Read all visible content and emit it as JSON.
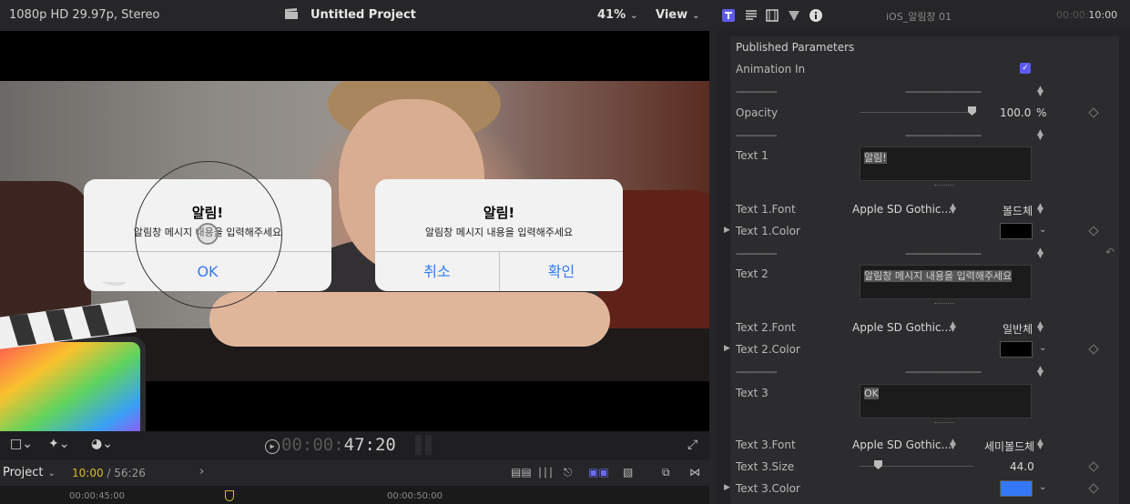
{
  "viewer": {
    "format": "1080p HD 29.97p, Stereo",
    "project_title": "Untitled Project",
    "zoom": "41%",
    "view_label": "View",
    "timecode_dim": "00:00:",
    "timecode": "47:20"
  },
  "alerts": [
    {
      "title": "알림!",
      "message": "알림창 메시지 내용을 입력해주세요",
      "buttons": [
        "OK"
      ]
    },
    {
      "title": "알림!",
      "message": "알림창 메시지 내용을 입력해주세요",
      "buttons": [
        "취소",
        "확인"
      ]
    }
  ],
  "timeline": {
    "project_label": "Project",
    "current_time": "10:00",
    "duration": "/ 56:26",
    "ruler": [
      "00:00:45:00",
      "00:00:50:00"
    ]
  },
  "inspector": {
    "clip_name": "iOS_알림창 01",
    "clip_dur_dim": "00:00:",
    "clip_dur": "10:00",
    "section": "Published Parameters",
    "animation_in_label": "Animation In",
    "dashes_left": "---------------",
    "dashes_right": "----------------------------",
    "opacity_label": "Opacity",
    "opacity_value": "100.0",
    "opacity_unit": "%",
    "text1_label": "Text 1",
    "text1_value": "알림!",
    "text1_font_label": "Text 1.Font",
    "text1_font": "Apple SD Gothic...",
    "text1_weight": "볼드체",
    "text1_color_label": "Text 1.Color",
    "text2_label": "Text 2",
    "text2_value": "알림창 메시지 내용을 입력해주세요",
    "text2_font_label": "Text 2.Font",
    "text2_font": "Apple SD Gothic...",
    "text2_weight": "일반체",
    "text2_color_label": "Text 2.Color",
    "text3_label": "Text 3",
    "text3_value": "OK",
    "text3_font_label": "Text 3.Font",
    "text3_font": "Apple SD Gothic...",
    "text3_weight": "세미볼드체",
    "text3_size_label": "Text 3.Size",
    "text3_size": "44.0",
    "text3_color_label": "Text 3.Color"
  },
  "colors": {
    "text1_color": "#000000",
    "text2_color": "#000000",
    "text3_color": "#3478f6",
    "accent": "#5c5cf0"
  }
}
